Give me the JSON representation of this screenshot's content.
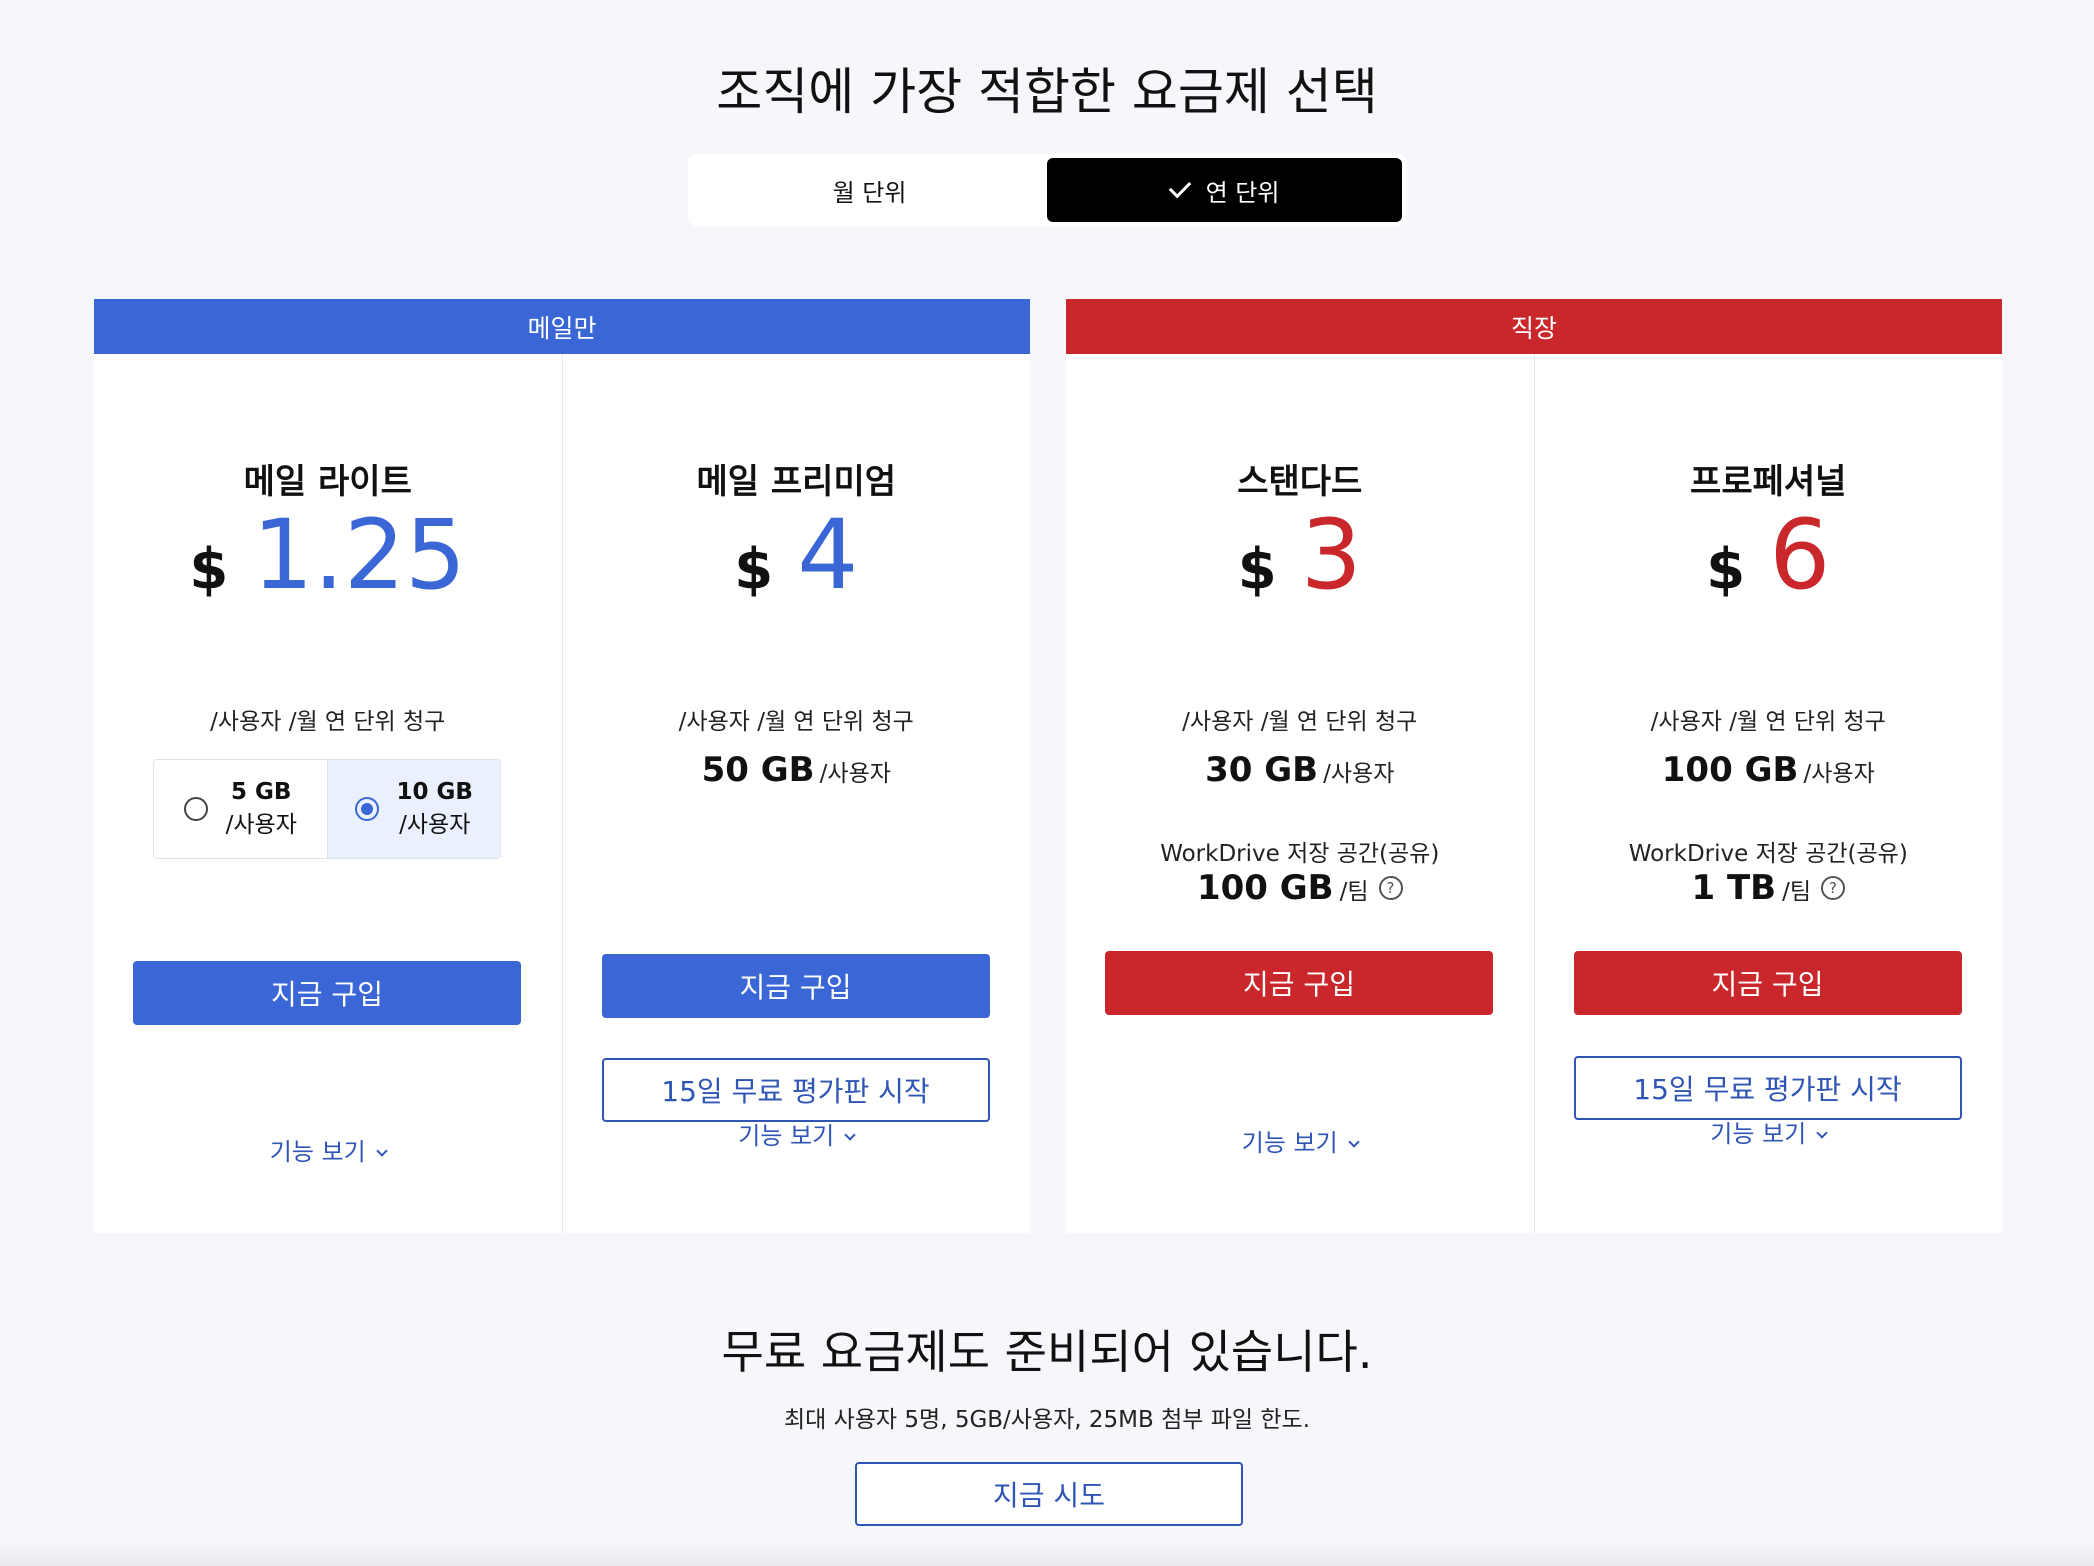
{
  "page": {
    "title": "조직에 가장 적합한 요금제 선택"
  },
  "billing_toggle": {
    "monthly": "월 단위",
    "yearly": "연 단위",
    "selected": "yearly"
  },
  "groups": {
    "mail": {
      "header": "메일만",
      "color": "#3a66d6",
      "plans": [
        {
          "name": "메일 라이트",
          "currency": "$",
          "price": "1.25",
          "billing": "/사용자 /월 연 단위 청구",
          "storage_options": [
            {
              "gb": "5 GB",
              "unit": "/사용자",
              "selected": false
            },
            {
              "gb": "10 GB",
              "unit": "/사용자",
              "selected": true
            }
          ],
          "buy": "지금 구입",
          "features": "기능 보기"
        },
        {
          "name": "메일 프리미엄",
          "currency": "$",
          "price": "4",
          "billing": "/사용자 /월 연 단위 청구",
          "storage": "50 GB",
          "storage_unit": "/사용자",
          "buy": "지금 구입",
          "trial": "15일 무료 평가판 시작",
          "features": "기능 보기"
        }
      ]
    },
    "workplace": {
      "header": "직장",
      "color": "#c9272b",
      "plans": [
        {
          "name": "스탠다드",
          "currency": "$",
          "price": "3",
          "billing": "/사용자 /월 연 단위 청구",
          "storage": "30 GB",
          "storage_unit": "/사용자",
          "workdrive_label": "WorkDrive 저장 공간(공유)",
          "workdrive_value": "100 GB",
          "workdrive_unit": "/팀",
          "buy": "지금 구입",
          "features": "기능 보기"
        },
        {
          "name": "프로페셔널",
          "currency": "$",
          "price": "6",
          "billing": "/사용자 /월 연 단위 청구",
          "storage": "100 GB",
          "storage_unit": "/사용자",
          "workdrive_label": "WorkDrive 저장 공간(공유)",
          "workdrive_value": "1 TB",
          "workdrive_unit": "/팀",
          "buy": "지금 구입",
          "trial": "15일 무료 평가판 시작",
          "features": "기능 보기"
        }
      ]
    }
  },
  "help_icon": "question-circle-icon",
  "free_plan": {
    "title": "무료 요금제도 준비되어 있습니다.",
    "subtitle": "최대 사용자 5명, 5GB/사용자, 25MB 첨부 파일 한도.",
    "button": "지금 시도"
  }
}
